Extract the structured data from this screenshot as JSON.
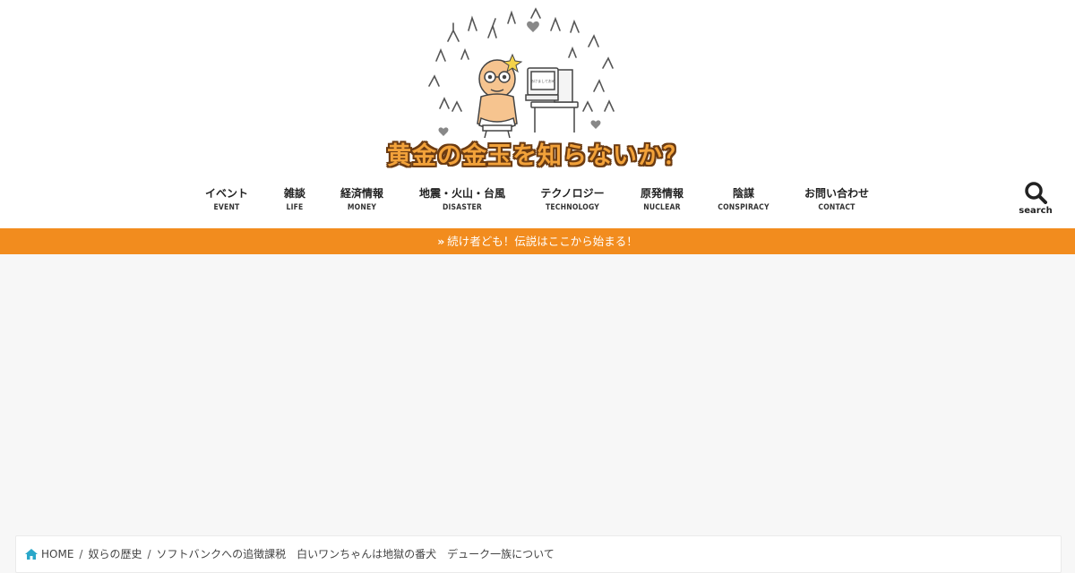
{
  "site": {
    "title": "黄金の金玉を知らないか？",
    "mascot_screen_text": "あけましておめ"
  },
  "nav": {
    "items": [
      {
        "jp": "イベント",
        "en": "EVENT"
      },
      {
        "jp": "雑談",
        "en": "LIFE"
      },
      {
        "jp": "経済情報",
        "en": "MONEY"
      },
      {
        "jp": "地震・火山・台風",
        "en": "DISASTER"
      },
      {
        "jp": "テクノロジー",
        "en": "TECHNOLOGY"
      },
      {
        "jp": "原発情報",
        "en": "NUCLEAR"
      },
      {
        "jp": "陰謀",
        "en": "CONSPIRACY"
      },
      {
        "jp": "お問い合わせ",
        "en": "CONTACT"
      }
    ],
    "search_label": "search"
  },
  "banner": {
    "chevron": "»",
    "text": "続け者ども！伝説はここから始まる！"
  },
  "breadcrumb": {
    "home": "HOME",
    "category": "奴らの歴史",
    "current": "ソフトバンクへの追徴課税　白いワンちゃんは地獄の番犬　デューク一族について"
  },
  "colors": {
    "accent_orange": "#f28c1e",
    "logo_fill": "#f2a23a",
    "logo_outline": "#6b3b12",
    "home_icon": "#2aa7c9"
  }
}
